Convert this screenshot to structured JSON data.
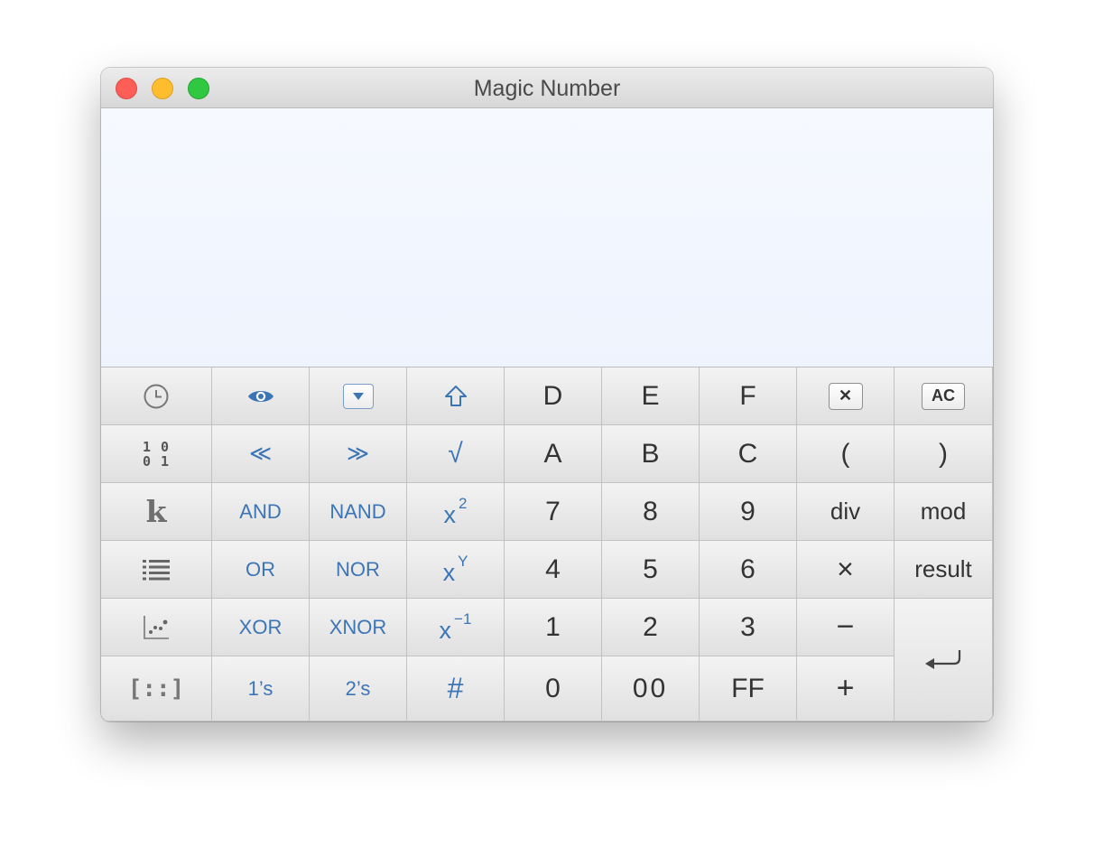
{
  "window": {
    "title": "Magic Number"
  },
  "display": {
    "expression": "",
    "result": ""
  },
  "keys": {
    "history": "history-icon",
    "bits_label_top": "1 0",
    "bits_label_bottom": "0 1",
    "constants_label": "k",
    "list_icon": "list-icon",
    "plot_icon": "scatter-plot-icon",
    "matrix_label": "[::]",
    "view": "eye-icon",
    "dropdown": "dropdown-icon",
    "shift": "shift-up-icon",
    "shift_left": "≪",
    "shift_right": "≫",
    "sqrt": "√",
    "and": "AND",
    "nand": "NAND",
    "or": "OR",
    "nor": "NOR",
    "xor": "XOR",
    "xnor": "XNOR",
    "ones_comp": "1’s",
    "twos_comp": "2’s",
    "hash": "#",
    "x_base": "x",
    "sq_exp": "2",
    "pow_exp": "Y",
    "inv_exp": "−1",
    "d": "D",
    "e": "E",
    "f": "F",
    "a": "A",
    "b": "B",
    "c": "C",
    "d7": "7",
    "d8": "8",
    "d9": "9",
    "d4": "4",
    "d5": "5",
    "d6": "6",
    "d1": "1",
    "d2": "2",
    "d3": "3",
    "d0": "0",
    "d00": "00",
    "ff": "FF",
    "delete": "✕",
    "all_clear": "AC",
    "lparen": "(",
    "rparen": ")",
    "div": "div",
    "mod": "mod",
    "multiply": "×",
    "result": "result",
    "minus": "−",
    "plus": "+",
    "enter": "enter-icon"
  },
  "colors": {
    "accent": "#3c75b5",
    "display_bg": "#f2f6fe",
    "close": "#fd5f57",
    "minimize": "#fdbd2e",
    "maximize": "#30c841"
  }
}
